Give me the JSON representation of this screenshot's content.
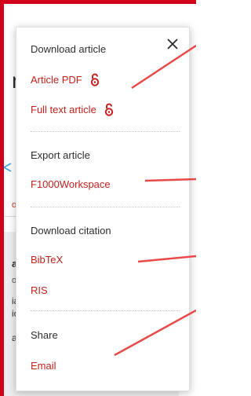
{
  "background": {
    "heading_fragment": "n",
    "link_fragment": "os",
    "side_text_1": "a",
    "side_text_2": "on",
    "side_text_3": "ia\nio",
    "side_text_4": "al"
  },
  "panel": {
    "download_article": {
      "title": "Download article",
      "items": [
        {
          "label": "Article PDF",
          "icon": "open-access-lock-icon"
        },
        {
          "label": "Full text article",
          "icon": "open-access-lock-icon"
        }
      ]
    },
    "export_article": {
      "title": "Export article",
      "items": [
        {
          "label": "F1000Workspace"
        }
      ]
    },
    "download_citation": {
      "title": "Download citation",
      "items": [
        {
          "label": "BibTeX"
        },
        {
          "label": "RIS"
        }
      ]
    },
    "share": {
      "title": "Share",
      "items": [
        {
          "label": "Email"
        }
      ]
    },
    "close_icon": "close-icon"
  },
  "colors": {
    "frame": "#d0021b",
    "link": "#c0221e",
    "annotation": "#e84a4a",
    "pointer": "#3ba4e0"
  }
}
